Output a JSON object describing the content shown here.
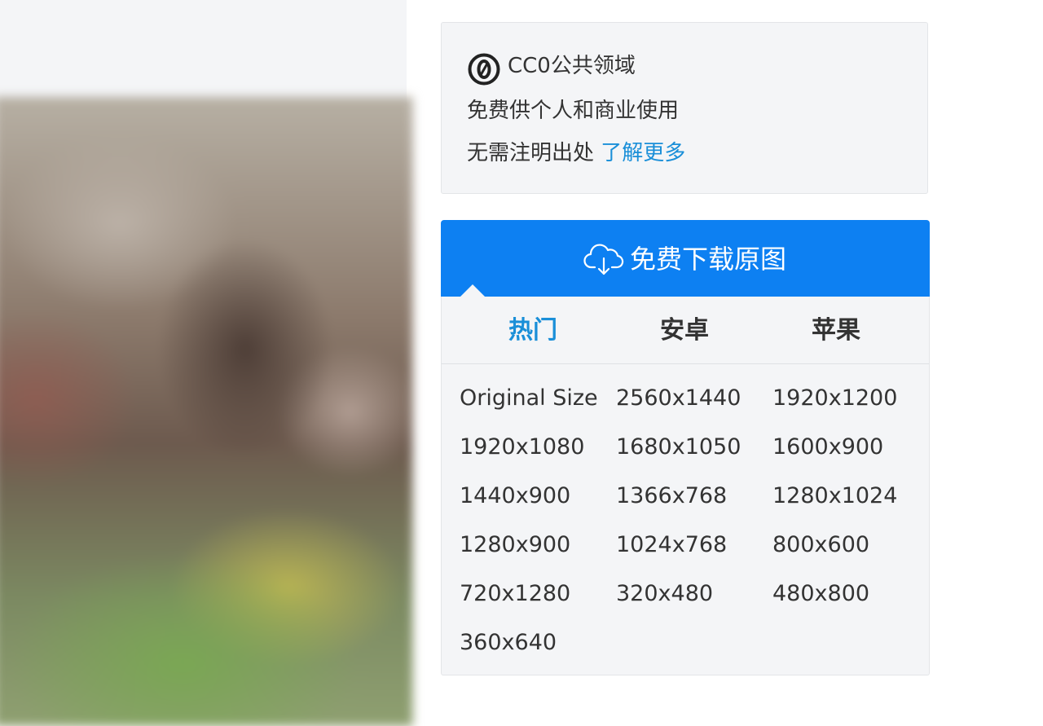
{
  "license": {
    "title": "CC0公共领域",
    "line1": "免费供个人和商业使用",
    "line2": "无需注明出处",
    "learn_more": "了解更多"
  },
  "download": {
    "label": "免费下载原图"
  },
  "tabs": [
    {
      "label": "热门",
      "active": true
    },
    {
      "label": "安卓",
      "active": false
    },
    {
      "label": "苹果",
      "active": false
    }
  ],
  "sizes": [
    "Original Size",
    "2560x1440",
    "1920x1200",
    "1920x1080",
    "1680x1050",
    "1600x900",
    "1440x900",
    "1366x768",
    "1280x1024",
    "1280x900",
    "1024x768",
    "800x600",
    "720x1280",
    "320x480",
    "480x800",
    "360x640"
  ],
  "colors": {
    "accent": "#0d80f2",
    "link": "#1a8fd8",
    "panel_bg": "#f4f5f7"
  }
}
